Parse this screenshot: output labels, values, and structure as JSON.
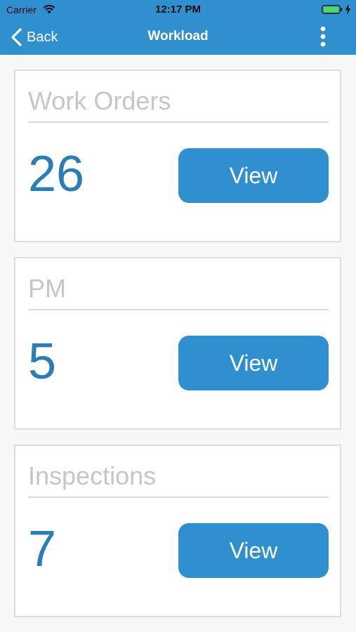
{
  "status_bar": {
    "carrier": "Carrier",
    "time": "12:17 PM",
    "icons": [
      "wifi-icon",
      "battery-icon",
      "charging-icon"
    ]
  },
  "nav": {
    "back_label": "Back",
    "title": "Workload",
    "back_icon": "chevron-left-icon",
    "more_icon": "more-vertical-icon"
  },
  "cards": [
    {
      "title": "Work Orders",
      "count": "26",
      "button_label": "View"
    },
    {
      "title": "PM",
      "count": "5",
      "button_label": "View"
    },
    {
      "title": "Inspections",
      "count": "7",
      "button_label": "View"
    }
  ],
  "colors": {
    "brand_blue": "#2f8fcf",
    "count_blue": "#2a7db6",
    "title_gray": "#c6c6c6",
    "background": "#f7f7f7"
  }
}
